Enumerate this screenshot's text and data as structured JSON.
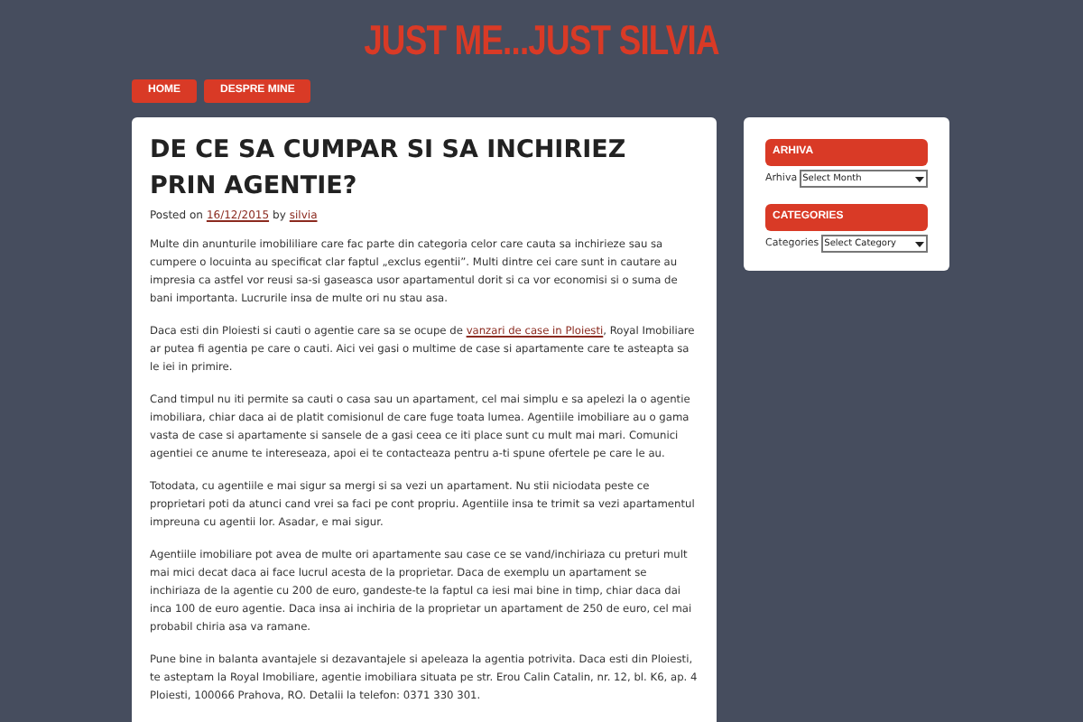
{
  "site_title": "JUST ME...JUST SILVIA",
  "nav": [
    {
      "label": "HOME",
      "selected": false
    },
    {
      "label": "DESPRE MINE",
      "selected": false
    }
  ],
  "post": {
    "title": "DE CE SA CUMPAR SI SA INCHIRIEZ PRIN AGENTIE?",
    "meta": {
      "posted_on": "Posted on",
      "date": "16/12/2015",
      "by": "by",
      "author": "silvia"
    },
    "paragraphs": [
      {
        "text": "Multe din anunturile imobililiare care fac parte din categoria celor care cauta sa inchirieze sau sa cumpere o locuinta au specificat clar faptul „exclus egentii”. Multi dintre cei care sunt in cautare au impresia ca astfel vor reusi sa-si gaseasca usor apartamentul dorit si ca vor economisi si o suma de bani importanta. Lucrurile insa de multe ori nu stau asa."
      },
      {
        "text": "Daca esti din Ploiesti si cauti o agentie care sa se ocupe de ",
        "link": "vanzari de case in Ploiesti",
        "after": ", Royal Imobiliare ar putea fi agentia pe care o cauti. Aici vei gasi o multime de case si apartamente care te asteapta sa le iei in primire."
      },
      {
        "text": "Cand timpul nu iti permite sa cauti o casa sau un apartament, cel mai simplu e sa apelezi la o agentie imobiliara, chiar daca ai de platit comisionul de care fuge toata lumea. Agentiile imobiliare au o gama vasta de case si apartamente si sansele de a gasi ceea ce iti place sunt cu mult mai mari. Comunici agentiei ce anume te intereseaza, apoi ei te contacteaza pentru a-ti spune ofertele pe care le au."
      },
      {
        "text": "Totodata, cu agentiile e mai sigur sa mergi si sa vezi un apartament. Nu stii niciodata peste ce proprietari poti da atunci cand vrei sa faci pe cont propriu. Agentiile insa te trimit sa vezi apartamentul impreuna cu agentii lor. Asadar, e mai sigur."
      },
      {
        "text": "Agentiile imobiliare pot avea de multe ori apartamente sau case ce se vand/inchiriaza cu preturi mult mai mici decat daca ai face lucrul acesta de la proprietar. Daca de exemplu un apartament se inchiriaza de la agentie cu 200 de euro, gandeste-te la faptul ca iesi mai bine in timp, chiar daca dai inca 100 de euro agentie. Daca insa ai inchiria de la proprietar un apartament de 250 de euro, cel mai probabil chiria asa va ramane."
      },
      {
        "text": "Pune bine in balanta avantajele si dezavantajele si apeleaza la agentia potrivita. Daca esti din Ploiesti, te asteptam la Royal Imobiliare, agentie imobiliara situata pe str. Erou Calin Catalin, nr. 12, bl. K6, ap. 4 Ploiesti, 100066 Prahova, RO. Detalii la telefon: 0371 330 301."
      }
    ]
  },
  "sidebar": {
    "widgets": [
      {
        "heading": "ARHIVA",
        "label": "Arhiva",
        "value": "Select Month"
      },
      {
        "heading": "CATEGORIES",
        "label": "Categories",
        "value": "Select Category"
      }
    ]
  }
}
